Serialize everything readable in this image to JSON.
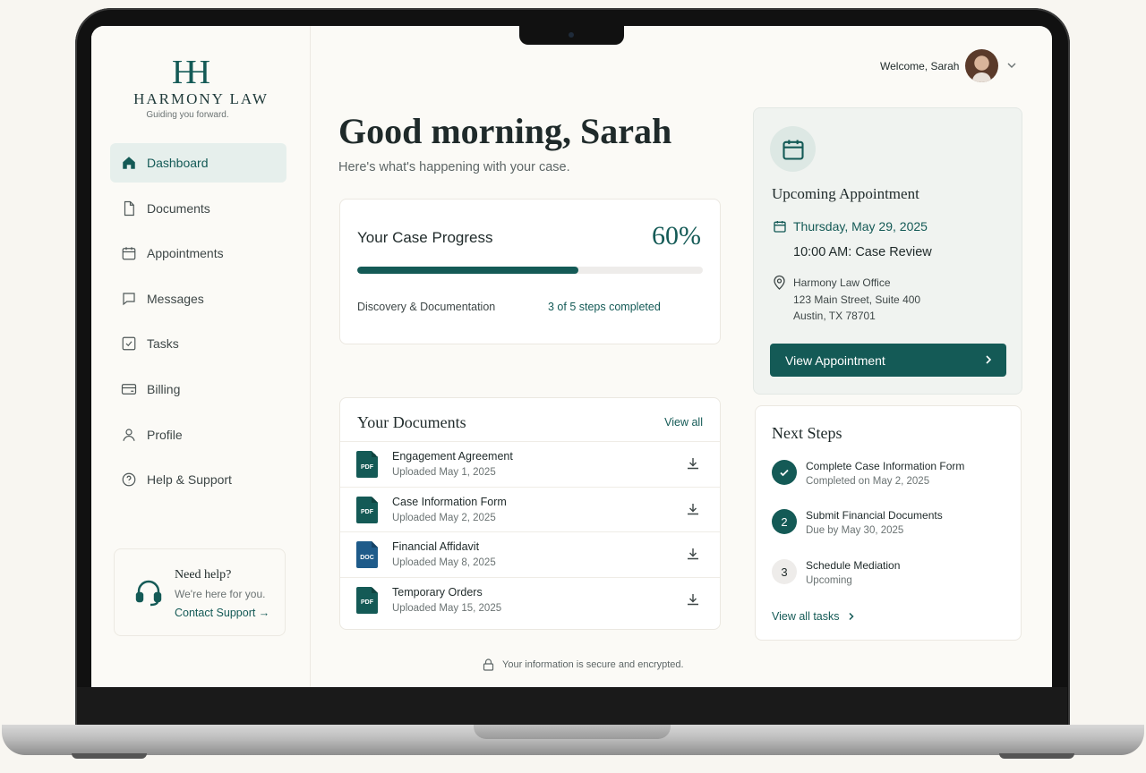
{
  "brand": {
    "mark": "H",
    "name": "HARMONY LAW",
    "tagline": "Guiding you forward."
  },
  "nav": [
    {
      "label": "Dashboard",
      "icon": "home-icon"
    },
    {
      "label": "Documents",
      "icon": "document-icon"
    },
    {
      "label": "Appointments",
      "icon": "calendar-icon"
    },
    {
      "label": "Messages",
      "icon": "message-icon"
    },
    {
      "label": "Tasks",
      "icon": "checkbox-icon"
    },
    {
      "label": "Billing",
      "icon": "card-icon"
    },
    {
      "label": "Profile",
      "icon": "user-icon"
    },
    {
      "label": "Help & Support",
      "icon": "help-icon"
    }
  ],
  "help": {
    "title": "Need help?",
    "subtitle": "We're here for you.",
    "link": "Contact Support →"
  },
  "header": {
    "welcome": "Welcome, Sarah"
  },
  "greeting": {
    "title": "Good morning, Sarah",
    "subtitle": "Here's what's happening with your case."
  },
  "progress": {
    "title": "Your Case Progress",
    "percent_label": "60%",
    "fraction": 0.64,
    "stage": "Discovery & Documentation",
    "steps_label": "3 of 5 steps completed"
  },
  "documents": {
    "title": "Your Documents",
    "view_all": "View all",
    "items": [
      {
        "type": "PDF",
        "name": "Engagement Agreement",
        "date": "Uploaded May 1, 2025"
      },
      {
        "type": "PDF",
        "name": "Case Information Form",
        "date": "Uploaded May 2, 2025"
      },
      {
        "type": "DOC",
        "name": "Financial Affidavit",
        "date": "Uploaded May 8, 2025"
      },
      {
        "type": "PDF",
        "name": "Temporary Orders",
        "date": "Uploaded May 15, 2025"
      }
    ]
  },
  "security_note": "Your information is secure and encrypted.",
  "appointment": {
    "title": "Upcoming Appointment",
    "date": "Thursday, May 29, 2025",
    "time": "10:00 AM: Case Review",
    "address": [
      "Harmony Law Office",
      "123 Main Street, Suite 400",
      "Austin, TX 78701"
    ],
    "button": "View Appointment"
  },
  "next_steps": {
    "title": "Next Steps",
    "items": [
      {
        "marker": "",
        "name": "Complete Case Information Form",
        "sub": "Completed on May 2, 2025",
        "status": "done"
      },
      {
        "marker": "2",
        "name": "Submit Financial Documents",
        "sub": "Due by May 30, 2025",
        "status": "active"
      },
      {
        "marker": "3",
        "name": "Schedule Mediation",
        "sub": "Upcoming",
        "status": "pending"
      }
    ],
    "view_all": "View all tasks"
  },
  "colors": {
    "accent": "#145a56",
    "doc_blue": "#1e5b8a",
    "background": "#fbfaf6"
  }
}
